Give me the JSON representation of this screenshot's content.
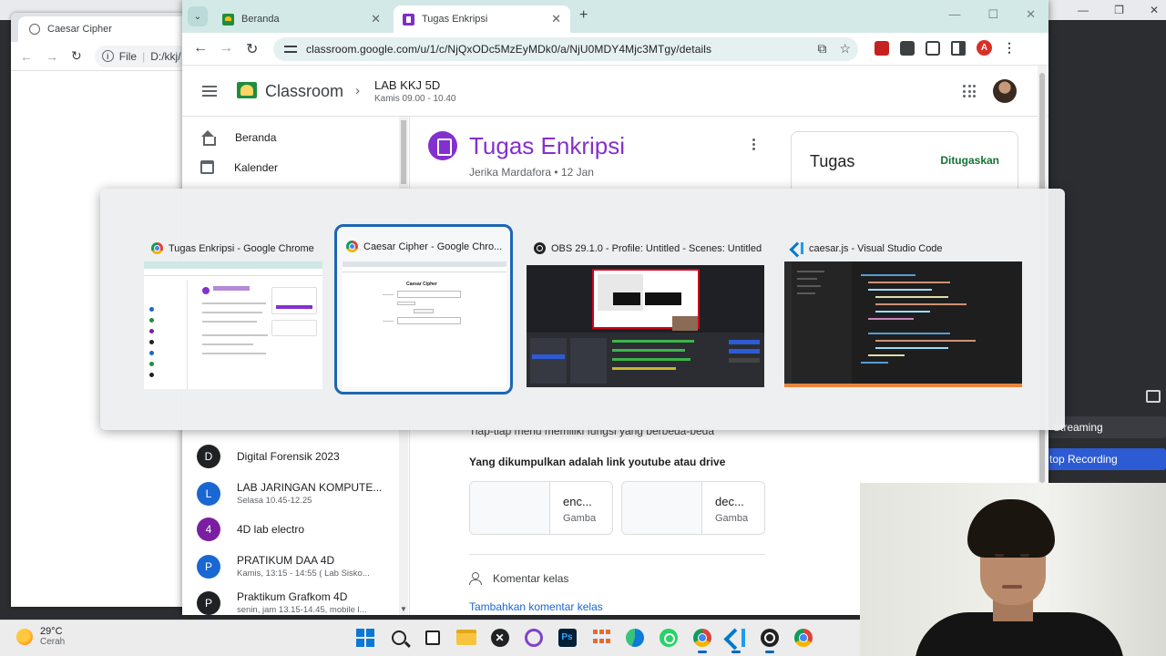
{
  "obs_background": {
    "streaming_label": "Streaming",
    "recording_label": "top Recording"
  },
  "caesar_window": {
    "tab_title": "Caesar Cipher",
    "url_prefix": "File",
    "url": "D:/kkj/"
  },
  "browser": {
    "tabs": [
      {
        "title": "Beranda"
      },
      {
        "title": "Tugas Enkripsi"
      }
    ],
    "url": "classroom.google.com/u/1/c/NjQxODc5MzEyMDk0/a/NjU0MDY4Mjc3MTgy/details",
    "profile_initial": "A"
  },
  "classroom": {
    "app_name": "Classroom",
    "class_name": "LAB KKJ 5D",
    "class_time": "Kamis 09.00 - 10.40"
  },
  "sidebar": {
    "nav": [
      {
        "label": "Beranda",
        "icon": "home-icon"
      },
      {
        "label": "Kalender",
        "icon": "calendar-icon"
      }
    ],
    "classes": [
      {
        "initial": "D",
        "name": "Digital Forensik 2023",
        "sub": "",
        "color": "#202124"
      },
      {
        "initial": "L",
        "name": "LAB JARINGAN KOMPUTE...",
        "sub": "Selasa 10.45-12.25",
        "color": "#1967d2"
      },
      {
        "initial": "4",
        "name": "4D lab electro",
        "sub": "",
        "color": "#7b1fa2"
      },
      {
        "initial": "P",
        "name": "PRATIKUM DAA 4D",
        "sub": "Kamis, 13:15 - 14:55 ( Lab Sisko...",
        "color": "#1967d2"
      },
      {
        "initial": "P",
        "name": "Praktikum Grafkom 4D",
        "sub": "senin, jam 13.15-14.45, mobile l...",
        "color": "#202124"
      }
    ]
  },
  "assignment": {
    "title": "Tugas Enkripsi",
    "author_date": "Jerika Mardafora • 12 Jan",
    "partial_text": "Tiap-tiap menu memiliki fungsi yang berbeda-beda",
    "collect_note": "Yang dikumpulkan adalah link youtube atau drive",
    "attachments": [
      {
        "name": "enc...",
        "type": "Gamba"
      },
      {
        "name": "dec...",
        "type": "Gamba"
      }
    ],
    "comments_label": "Komentar kelas",
    "add_comment": "Tambahkan komentar kelas"
  },
  "tugas_card": {
    "title": "Tugas",
    "status": "Ditugaskan"
  },
  "switcher": {
    "items": [
      {
        "title": "Tugas Enkripsi - Google Chrome",
        "icon": "chrome-icon",
        "selected": false
      },
      {
        "title": "Caesar Cipher - Google Chro...",
        "icon": "chrome-icon",
        "selected": true
      },
      {
        "title": "OBS 29.1.0 - Profile: Untitled - Scenes: Untitled",
        "icon": "obs-icon",
        "selected": false
      },
      {
        "title": "caesar.js - Visual Studio Code",
        "icon": "vscode-icon",
        "selected": false
      }
    ],
    "caesar_thumb_title": "Caesar Cipher"
  },
  "taskbar": {
    "temperature": "29°C",
    "condition": "Cerah"
  },
  "colors": {
    "classroom_purple": "#8430ce",
    "selection_border": "#1d66b3",
    "tabbar": "#d3e9e7",
    "status_green": "#137333"
  }
}
